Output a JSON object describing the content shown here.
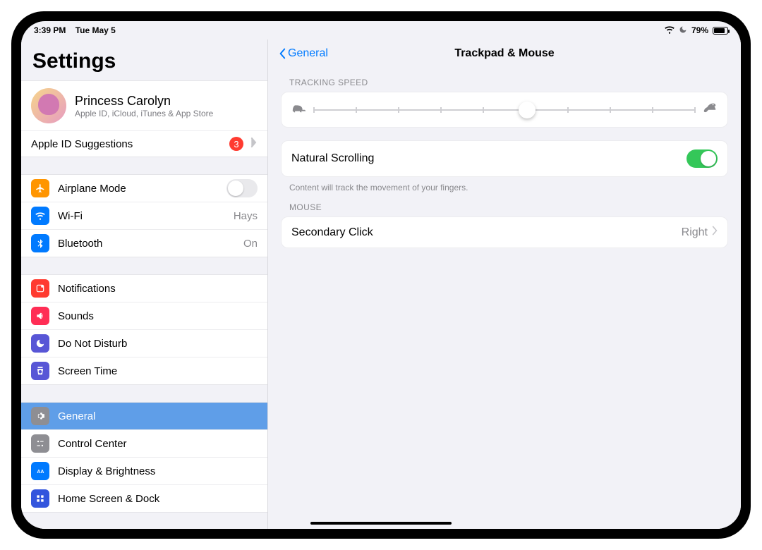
{
  "statusbar": {
    "time": "3:39 PM",
    "date": "Tue May 5",
    "battery_pct": "79%"
  },
  "sidebar": {
    "title": "Settings",
    "profile": {
      "name": "Princess Carolyn",
      "sub": "Apple ID, iCloud, iTunes & App Store"
    },
    "apple_id_suggestions": {
      "label": "Apple ID Suggestions",
      "badge": "3"
    },
    "items": [
      {
        "label": "Airplane Mode",
        "icon_name": "airplane-icon",
        "icon_bg": "#ff9500",
        "type": "toggle",
        "on": false
      },
      {
        "label": "Wi-Fi",
        "icon_name": "wifi-icon",
        "icon_bg": "#007aff",
        "value": "Hays",
        "chev": true
      },
      {
        "label": "Bluetooth",
        "icon_name": "bluetooth-icon",
        "icon_bg": "#007aff",
        "value": "On",
        "chev": true
      }
    ],
    "items2": [
      {
        "label": "Notifications",
        "icon_name": "notifications-icon",
        "icon_bg": "#ff3b30"
      },
      {
        "label": "Sounds",
        "icon_name": "sounds-icon",
        "icon_bg": "#ff2d55"
      },
      {
        "label": "Do Not Disturb",
        "icon_name": "dnd-icon",
        "icon_bg": "#5856d6"
      },
      {
        "label": "Screen Time",
        "icon_name": "screentime-icon",
        "icon_bg": "#5856d6"
      }
    ],
    "items3": [
      {
        "label": "General",
        "icon_name": "general-icon",
        "icon_bg": "#8e8e93",
        "selected": true
      },
      {
        "label": "Control Center",
        "icon_name": "controlcenter-icon",
        "icon_bg": "#8e8e93"
      },
      {
        "label": "Display & Brightness",
        "icon_name": "display-icon",
        "icon_bg": "#007aff"
      },
      {
        "label": "Home Screen & Dock",
        "icon_name": "home-icon",
        "icon_bg": "#3355dd"
      }
    ]
  },
  "detail": {
    "back_label": "General",
    "title": "Trackpad & Mouse",
    "tracking_speed": {
      "header": "TRACKING SPEED",
      "ticks": 10,
      "position_pct": 56
    },
    "natural_scrolling": {
      "label": "Natural Scrolling",
      "on": true,
      "footnote": "Content will track the movement of your fingers."
    },
    "mouse_header": "MOUSE",
    "secondary_click": {
      "label": "Secondary Click",
      "value": "Right"
    }
  },
  "colors": {
    "accent": "#007aff",
    "toggle_on": "#34c759",
    "badge": "#ff3b30",
    "selected_row": "#5f9ee8"
  }
}
